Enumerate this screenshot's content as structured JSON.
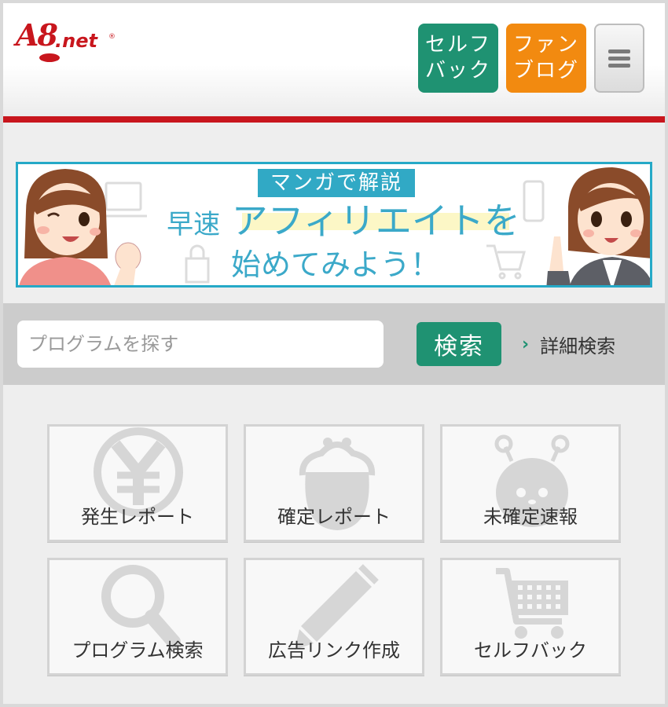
{
  "header": {
    "logo_text": "A8",
    "logo_suffix": ".net",
    "selfback_label": "セルフ\nバック",
    "fanblog_label": "ファン\nブログ",
    "menu_icon": "hamburger-icon"
  },
  "banner": {
    "tag": "マンガで解説",
    "line1_small": "早速",
    "line1_big": "アフィリエイトを",
    "line2": "始めてみよう！"
  },
  "search": {
    "placeholder": "プログラムを探す",
    "button_label": "検索",
    "advanced_link": "詳細検索"
  },
  "tiles": [
    {
      "label": "発生レポート",
      "icon": "yen-icon"
    },
    {
      "label": "確定レポート",
      "icon": "purse-icon"
    },
    {
      "label": "未確定速報",
      "icon": "bug-mascot-icon"
    },
    {
      "label": "プログラム検索",
      "icon": "magnifier-icon"
    },
    {
      "label": "広告リンク作成",
      "icon": "pencil-icon"
    },
    {
      "label": "セルフバック",
      "icon": "cart-icon"
    }
  ],
  "colors": {
    "brand_red": "#c8161d",
    "green": "#1f9272",
    "orange": "#f28a10",
    "banner_blue": "#31a9c5"
  }
}
